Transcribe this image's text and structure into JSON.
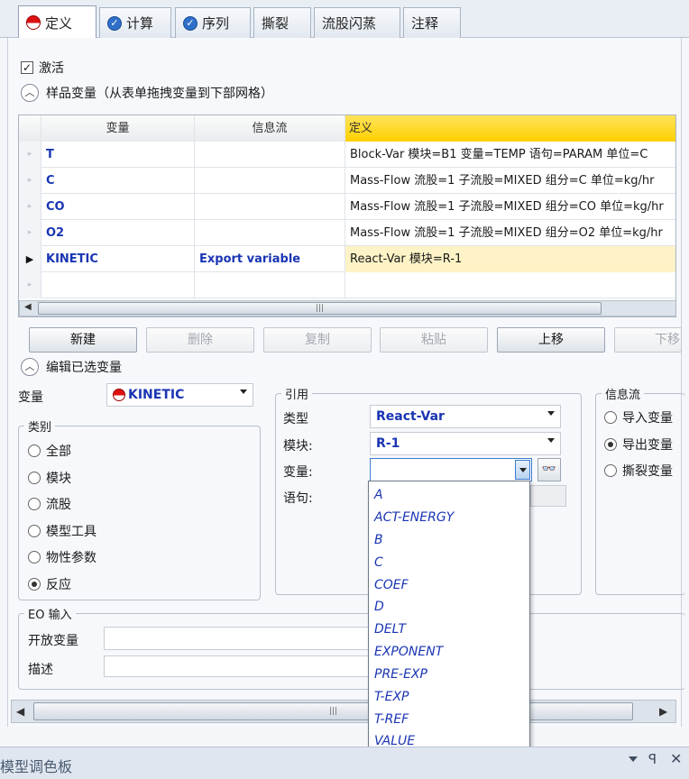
{
  "tabs": [
    {
      "label": "定义",
      "icon": "red-circle-icon",
      "active": true
    },
    {
      "label": "计算",
      "icon": "blue-check-icon"
    },
    {
      "label": "序列",
      "icon": "blue-check-icon"
    },
    {
      "label": "撕裂"
    },
    {
      "label": "流股闪蒸"
    },
    {
      "label": "注释"
    }
  ],
  "activate": {
    "label": "激活",
    "checked": true
  },
  "sample_section": {
    "title": "样品变量（从表单拖拽变量到下部网格）"
  },
  "grid": {
    "headers": [
      "变量",
      "信息流",
      "定义"
    ],
    "rows": [
      {
        "var": "T",
        "flow": "",
        "def": "Block-Var 模块=B1 变量=TEMP 语句=PARAM 单位=C"
      },
      {
        "var": "C",
        "flow": "",
        "def": "Mass-Flow 流股=1 子流股=MIXED 组分=C 单位=kg/hr"
      },
      {
        "var": "CO",
        "flow": "",
        "def": "Mass-Flow 流股=1 子流股=MIXED 组分=CO 单位=kg/hr"
      },
      {
        "var": "O2",
        "flow": "",
        "def": "Mass-Flow 流股=1 子流股=MIXED 组分=O2 单位=kg/hr"
      },
      {
        "var": "KINETIC",
        "flow": "Export variable",
        "def": "React-Var 模块=R-1"
      }
    ]
  },
  "toolbar": {
    "new": "新建",
    "delete": "删除",
    "copy": "复制",
    "paste": "粘贴",
    "up": "上移",
    "down": "下移"
  },
  "edit_section": {
    "title": "编辑已选变量"
  },
  "variable": {
    "label": "变量",
    "value": "KINETIC"
  },
  "category": {
    "title": "类别",
    "options": [
      "全部",
      "模块",
      "流股",
      "模型工具",
      "物性参数",
      "反应"
    ],
    "selected": "反应"
  },
  "reference": {
    "title": "引用",
    "type_label": "类型",
    "type_value": "React-Var",
    "block_label": "模块:",
    "block_value": "R-1",
    "var_label": "变量:",
    "var_value": "",
    "stmt_label": "语句:"
  },
  "infoflow": {
    "title": "信息流",
    "options": [
      "导入变量",
      "导出变量",
      "撕裂变量"
    ],
    "selected": "导出变量"
  },
  "eo": {
    "title": "EO 输入",
    "open_label": "开放变量",
    "desc_label": "描述"
  },
  "dropdown": {
    "items": [
      "A",
      "ACT-ENERGY",
      "B",
      "C",
      "COEF",
      "D",
      "DELT",
      "EXPONENT",
      "PRE-EXP",
      "T-EXP",
      "T-REF",
      "VALUE"
    ]
  },
  "palette": {
    "title": "模型调色板"
  },
  "colors": {
    "accent_header": "#ffd400",
    "selected_row": "#fdf3c6",
    "link_blue": "#1a35b3"
  }
}
